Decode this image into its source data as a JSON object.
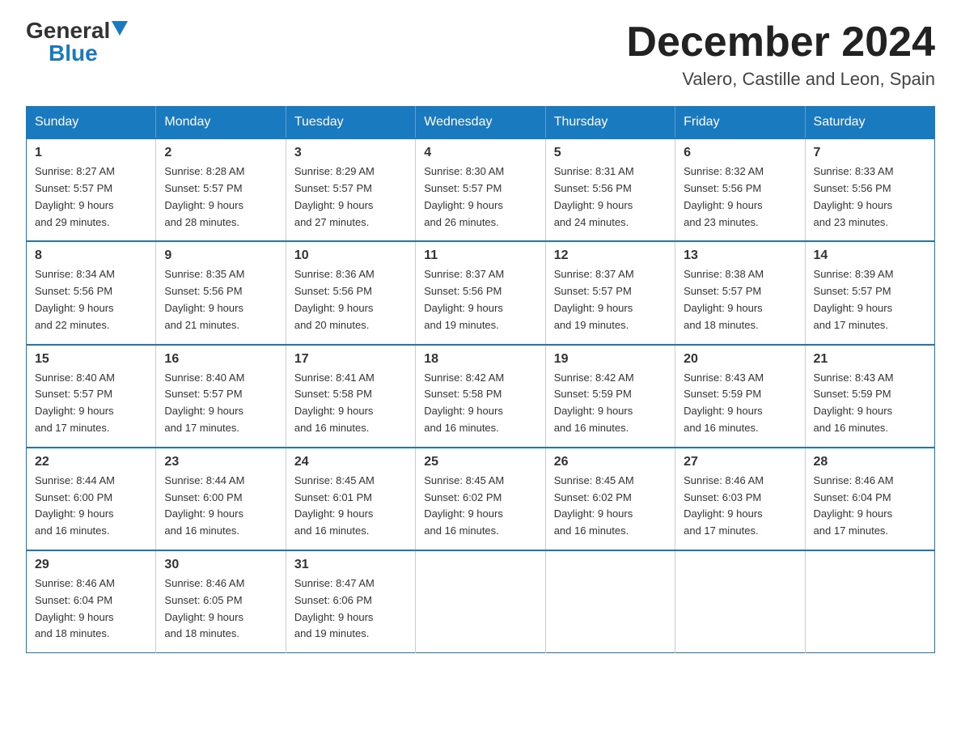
{
  "header": {
    "logo_general": "General",
    "logo_blue": "Blue",
    "month_title": "December 2024",
    "location": "Valero, Castille and Leon, Spain"
  },
  "weekdays": [
    "Sunday",
    "Monday",
    "Tuesday",
    "Wednesday",
    "Thursday",
    "Friday",
    "Saturday"
  ],
  "weeks": [
    [
      {
        "day": "1",
        "sunrise": "8:27 AM",
        "sunset": "5:57 PM",
        "daylight": "9 hours and 29 minutes."
      },
      {
        "day": "2",
        "sunrise": "8:28 AM",
        "sunset": "5:57 PM",
        "daylight": "9 hours and 28 minutes."
      },
      {
        "day": "3",
        "sunrise": "8:29 AM",
        "sunset": "5:57 PM",
        "daylight": "9 hours and 27 minutes."
      },
      {
        "day": "4",
        "sunrise": "8:30 AM",
        "sunset": "5:57 PM",
        "daylight": "9 hours and 26 minutes."
      },
      {
        "day": "5",
        "sunrise": "8:31 AM",
        "sunset": "5:56 PM",
        "daylight": "9 hours and 24 minutes."
      },
      {
        "day": "6",
        "sunrise": "8:32 AM",
        "sunset": "5:56 PM",
        "daylight": "9 hours and 23 minutes."
      },
      {
        "day": "7",
        "sunrise": "8:33 AM",
        "sunset": "5:56 PM",
        "daylight": "9 hours and 23 minutes."
      }
    ],
    [
      {
        "day": "8",
        "sunrise": "8:34 AM",
        "sunset": "5:56 PM",
        "daylight": "9 hours and 22 minutes."
      },
      {
        "day": "9",
        "sunrise": "8:35 AM",
        "sunset": "5:56 PM",
        "daylight": "9 hours and 21 minutes."
      },
      {
        "day": "10",
        "sunrise": "8:36 AM",
        "sunset": "5:56 PM",
        "daylight": "9 hours and 20 minutes."
      },
      {
        "day": "11",
        "sunrise": "8:37 AM",
        "sunset": "5:56 PM",
        "daylight": "9 hours and 19 minutes."
      },
      {
        "day": "12",
        "sunrise": "8:37 AM",
        "sunset": "5:57 PM",
        "daylight": "9 hours and 19 minutes."
      },
      {
        "day": "13",
        "sunrise": "8:38 AM",
        "sunset": "5:57 PM",
        "daylight": "9 hours and 18 minutes."
      },
      {
        "day": "14",
        "sunrise": "8:39 AM",
        "sunset": "5:57 PM",
        "daylight": "9 hours and 17 minutes."
      }
    ],
    [
      {
        "day": "15",
        "sunrise": "8:40 AM",
        "sunset": "5:57 PM",
        "daylight": "9 hours and 17 minutes."
      },
      {
        "day": "16",
        "sunrise": "8:40 AM",
        "sunset": "5:57 PM",
        "daylight": "9 hours and 17 minutes."
      },
      {
        "day": "17",
        "sunrise": "8:41 AM",
        "sunset": "5:58 PM",
        "daylight": "9 hours and 16 minutes."
      },
      {
        "day": "18",
        "sunrise": "8:42 AM",
        "sunset": "5:58 PM",
        "daylight": "9 hours and 16 minutes."
      },
      {
        "day": "19",
        "sunrise": "8:42 AM",
        "sunset": "5:59 PM",
        "daylight": "9 hours and 16 minutes."
      },
      {
        "day": "20",
        "sunrise": "8:43 AM",
        "sunset": "5:59 PM",
        "daylight": "9 hours and 16 minutes."
      },
      {
        "day": "21",
        "sunrise": "8:43 AM",
        "sunset": "5:59 PM",
        "daylight": "9 hours and 16 minutes."
      }
    ],
    [
      {
        "day": "22",
        "sunrise": "8:44 AM",
        "sunset": "6:00 PM",
        "daylight": "9 hours and 16 minutes."
      },
      {
        "day": "23",
        "sunrise": "8:44 AM",
        "sunset": "6:00 PM",
        "daylight": "9 hours and 16 minutes."
      },
      {
        "day": "24",
        "sunrise": "8:45 AM",
        "sunset": "6:01 PM",
        "daylight": "9 hours and 16 minutes."
      },
      {
        "day": "25",
        "sunrise": "8:45 AM",
        "sunset": "6:02 PM",
        "daylight": "9 hours and 16 minutes."
      },
      {
        "day": "26",
        "sunrise": "8:45 AM",
        "sunset": "6:02 PM",
        "daylight": "9 hours and 16 minutes."
      },
      {
        "day": "27",
        "sunrise": "8:46 AM",
        "sunset": "6:03 PM",
        "daylight": "9 hours and 17 minutes."
      },
      {
        "day": "28",
        "sunrise": "8:46 AM",
        "sunset": "6:04 PM",
        "daylight": "9 hours and 17 minutes."
      }
    ],
    [
      {
        "day": "29",
        "sunrise": "8:46 AM",
        "sunset": "6:04 PM",
        "daylight": "9 hours and 18 minutes."
      },
      {
        "day": "30",
        "sunrise": "8:46 AM",
        "sunset": "6:05 PM",
        "daylight": "9 hours and 18 minutes."
      },
      {
        "day": "31",
        "sunrise": "8:47 AM",
        "sunset": "6:06 PM",
        "daylight": "9 hours and 19 minutes."
      },
      null,
      null,
      null,
      null
    ]
  ],
  "labels": {
    "sunrise": "Sunrise:",
    "sunset": "Sunset:",
    "daylight": "Daylight:"
  }
}
